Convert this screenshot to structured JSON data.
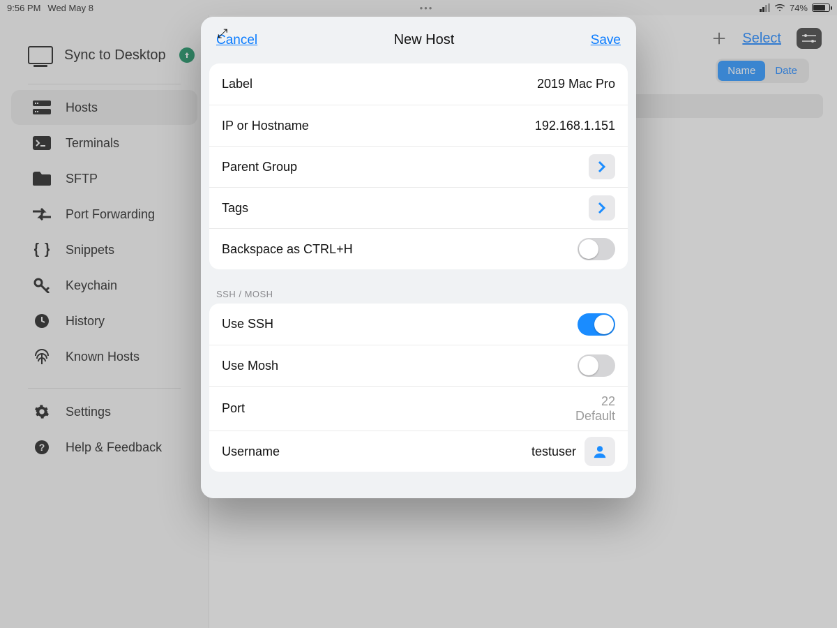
{
  "status": {
    "time": "9:56 PM",
    "date": "Wed May 8",
    "battery": "74%"
  },
  "sidebar": {
    "sync_label": "Sync to Desktop",
    "items": [
      {
        "label": "Hosts"
      },
      {
        "label": "Terminals"
      },
      {
        "label": "SFTP"
      },
      {
        "label": "Port Forwarding"
      },
      {
        "label": "Snippets"
      },
      {
        "label": "Keychain"
      },
      {
        "label": "History"
      },
      {
        "label": "Known Hosts"
      }
    ],
    "settings_label": "Settings",
    "help_label": "Help & Feedback"
  },
  "toolbar": {
    "select_label": "Select",
    "seg_name": "Name",
    "seg_date": "Date"
  },
  "modal": {
    "cancel": "Cancel",
    "title": "New Host",
    "save": "Save",
    "rows": {
      "label_title": "Label",
      "label_value": "2019 Mac Pro",
      "host_title": "IP or Hostname",
      "host_value": "192.168.1.151",
      "parent_group": "Parent Group",
      "tags": "Tags",
      "backspace": "Backspace as CTRL+H"
    },
    "section_ssh": "SSH / MOSH",
    "ssh": {
      "use_ssh": "Use SSH",
      "use_mosh": "Use Mosh",
      "port_label": "Port",
      "port_value": "22",
      "port_default": "Default",
      "username_label": "Username",
      "username_value": "testuser"
    }
  }
}
